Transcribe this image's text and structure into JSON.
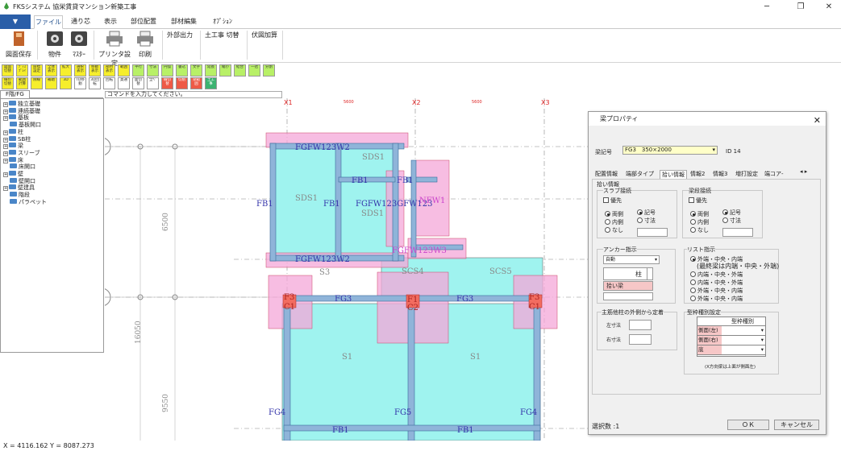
{
  "window": {
    "title": "FKSシステム 協栄賃貸マンション新築工事",
    "minimize": "─",
    "restore": "❐",
    "close": "✕"
  },
  "ribbon_tabs": [
    "ファイル",
    "通り芯",
    "表示",
    "部位配置",
    "部材編集",
    "ｵﾌﾟｼｮﾝ"
  ],
  "ribbon": {
    "save": "図面保存",
    "property": "物件",
    "master": "ﾏｽﾀｰ",
    "printer_setup": "プリンタ設定",
    "print": "印刷",
    "external_output": "外部出力",
    "construction_switch": "土工事 切替",
    "fuzu_add": "伏図加算"
  },
  "toolbar1": [
    "図面切替",
    "ﾃﾞｨｽﾌﾟﾚｲ",
    "座標設定",
    "全体表示",
    "拡大",
    "選択表示",
    "移動表示",
    "部材表示",
    "範囲",
    "平行",
    "寸法",
    "円弧",
    "書込",
    "文字",
    "延長",
    "縮小",
    "結合",
    "一括",
    "分割"
  ],
  "toolbar2": [
    "線の切替",
    "範囲計算",
    "除線",
    "補助",
    "3D",
    "TD移動",
    "3D回転",
    "回転",
    "貫通",
    "面切替",
    "全ﾍﾟ",
    "線切替",
    "切削",
    "梁範囲",
    "土工事"
  ],
  "tree_tab": "F階/FG",
  "tree": [
    "独立基礎",
    "連続基礎",
    "基板",
    "基板開口",
    "柱",
    "SB柱",
    "梁",
    "スリーブ",
    "床",
    "床開口",
    "壁",
    "壁開口",
    "壁建具",
    "階段",
    "パラペット"
  ],
  "command_placeholder": "コマンドを入力してください。",
  "status": "X = 4116.162 Y = 8087.273",
  "canvas": {
    "axis": [
      "X1",
      "X2",
      "X3"
    ],
    "axis_dims": [
      "5600",
      "5600"
    ],
    "vert_dims": [
      "6500",
      "16050",
      "9550"
    ],
    "labels": [
      "FGFW123W2",
      "SDS1",
      "FB1",
      "FB1",
      "FB1",
      "FB1",
      "SDS1",
      "FGFW123GFW123",
      "SDS1",
      "NFW1",
      "FGFW123W2",
      "FGFW123W3",
      "S3",
      "SCS4",
      "SCS5",
      "F3",
      "C1",
      "FG3",
      "F1",
      "C2",
      "FG3",
      "F3",
      "C1",
      "S1",
      "S1",
      "FG4",
      "FG5",
      "FG4",
      "FB1",
      "FB1"
    ]
  },
  "dialog": {
    "title": "梁プロパティ",
    "beam_symbol_label": "梁記号",
    "beam_symbol_value": "FG3　350×2000",
    "id": "ID 14",
    "tabs": [
      "配置情報",
      "端部タイプ",
      "拾い情報",
      "情報2",
      "情報3",
      "増打設定",
      "端コア-"
    ],
    "section": "拾い情報",
    "slab_conn": {
      "title": "スラブ接続",
      "priority": "優先",
      "opts1": [
        "両側",
        "内側",
        "なし"
      ],
      "opts2": [
        "記号",
        "寸法"
      ]
    },
    "beam_conn": {
      "title": "梁段接続",
      "priority": "優先",
      "opts1": [
        "両側",
        "内側",
        "なし"
      ],
      "opts2": [
        "記号",
        "寸法"
      ]
    },
    "anchor": {
      "title": "アンカー指示",
      "value": "自動",
      "col": "柱",
      "beam": "拾い梁"
    },
    "list": {
      "title": "リスト指示",
      "opts": [
        "外端・中央・内端",
        "内端・中央・外端",
        "内端・中央・外端",
        "外端・中央・内端",
        "外端・中央・内端"
      ],
      "note": "(最終梁は内端・中央・外端)"
    },
    "main_bar": {
      "title": "主筋他柱の外側から定着",
      "left": "左寸法",
      "right": "右寸法"
    },
    "form": {
      "title": "型枠種別設定",
      "header": "型枠種別",
      "rows": [
        "側面(左)",
        "側面(右)",
        "底"
      ],
      "note": "(X方向梁は上面が側面左)"
    },
    "selected": "選択数 :1",
    "ok": "ＯＫ",
    "cancel": "キャンセル"
  },
  "colors": {
    "accent": "#2a5ea8",
    "pink": "#f4a7d8",
    "cyan": "#9ff3ef",
    "beam": "#8fb4d9"
  }
}
